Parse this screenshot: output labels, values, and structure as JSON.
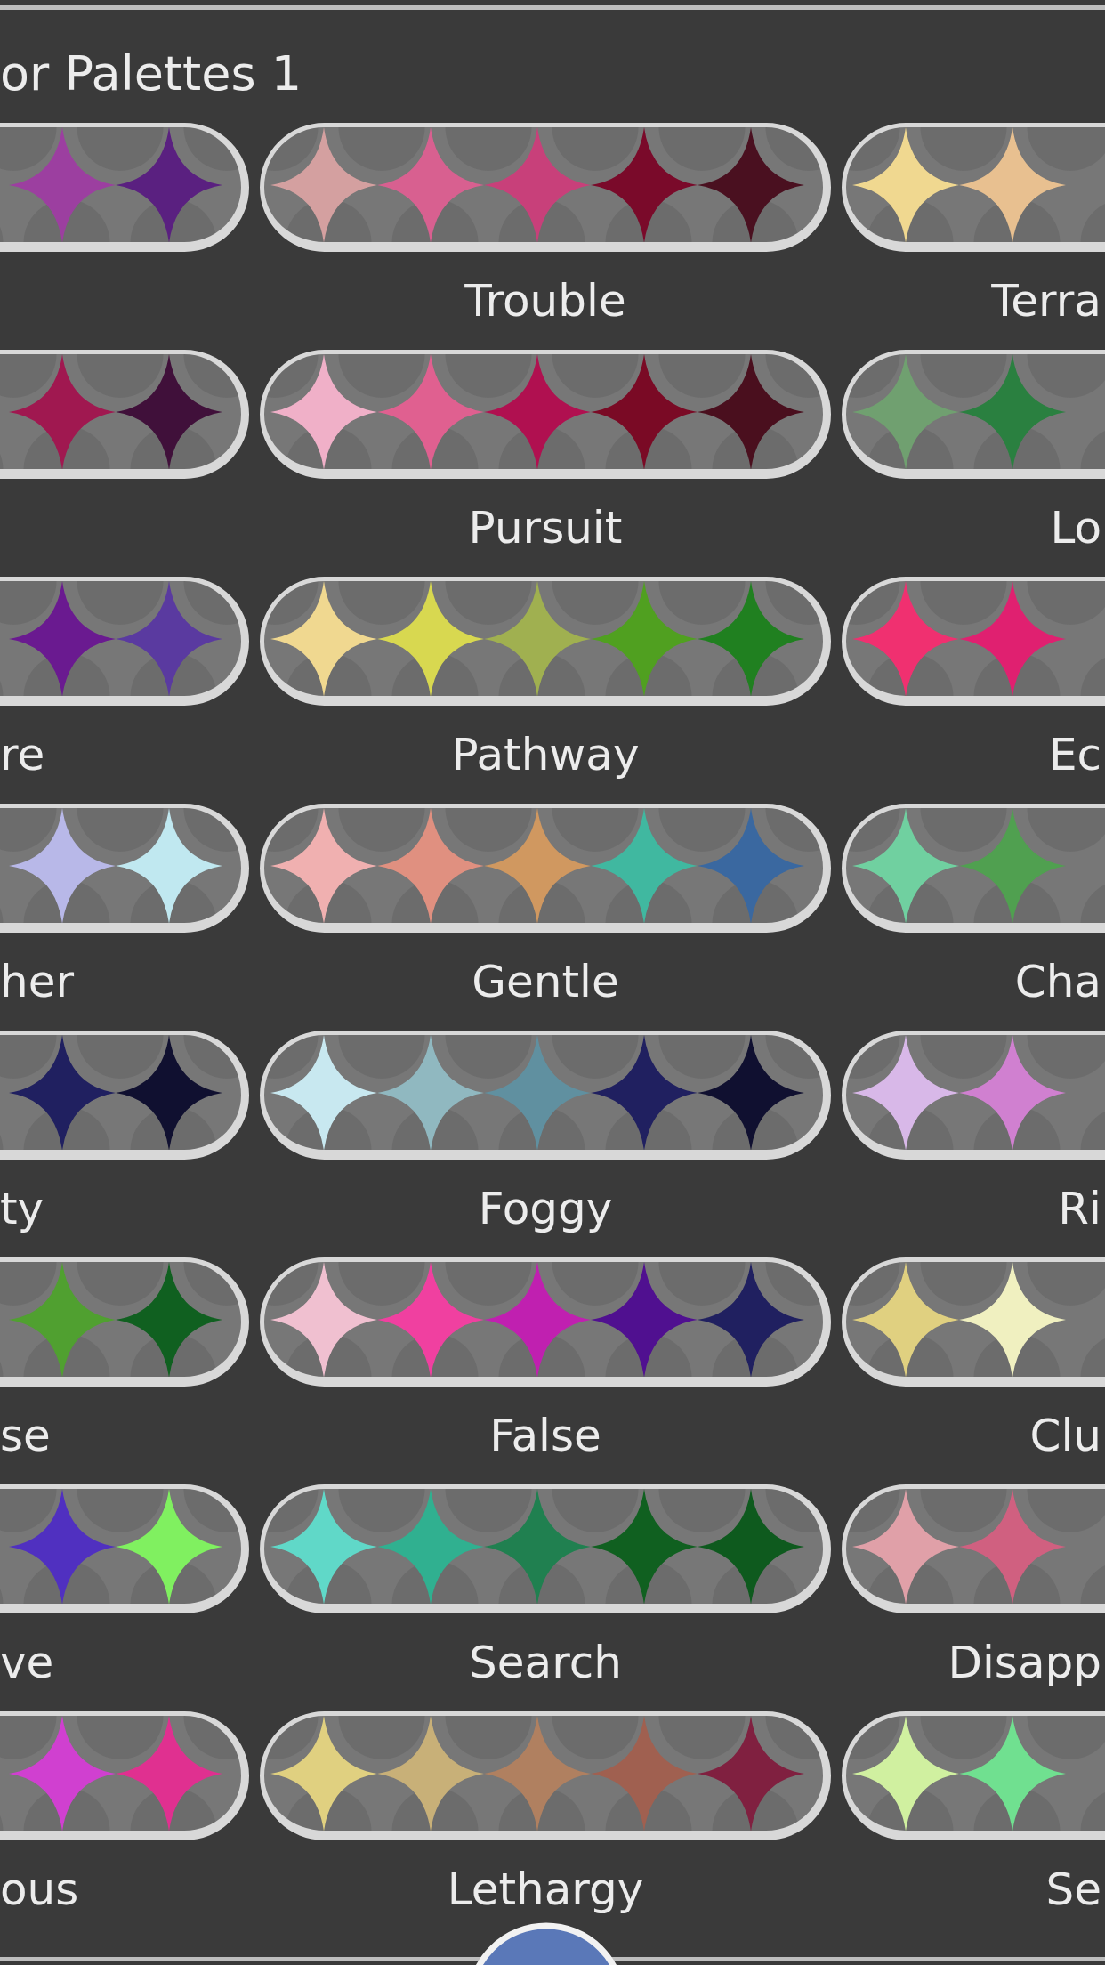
{
  "title": "or Palettes 1",
  "palettes": [
    {
      "kind": "left",
      "stars": [
        {
          "color": "#9c3fa0"
        },
        {
          "color": "#5a2080"
        }
      ]
    },
    {
      "kind": "middle",
      "label": "Trouble",
      "stars": [
        {
          "color": "#d4a0a0"
        },
        {
          "color": "#d86090"
        },
        {
          "color": "#c8407a"
        },
        {
          "color": "#7a0a2a"
        },
        {
          "color": "#4a1020"
        }
      ]
    },
    {
      "kind": "right",
      "label": "Terra",
      "stars": [
        {
          "color": "#f0d890"
        },
        {
          "color": "#e8c090"
        }
      ]
    },
    {
      "kind": "left",
      "stars": [
        {
          "color": "#a01850"
        },
        {
          "color": "#40103a"
        }
      ]
    },
    {
      "kind": "middle",
      "label": "Pursuit",
      "stars": [
        {
          "color": "#f0b0c8"
        },
        {
          "color": "#e06090"
        },
        {
          "color": "#b01050"
        },
        {
          "color": "#7a0a25"
        },
        {
          "color": "#4a0f1e"
        }
      ]
    },
    {
      "kind": "right",
      "label": "Lo",
      "stars": [
        {
          "color": "#70a070"
        },
        {
          "color": "#2a8040"
        }
      ]
    },
    {
      "kind": "left",
      "label": "re",
      "stars": [
        {
          "color": "#6a1a90"
        },
        {
          "color": "#5a3aa0"
        }
      ]
    },
    {
      "kind": "middle",
      "label": "Pathway",
      "stars": [
        {
          "color": "#f0d890"
        },
        {
          "color": "#d8d850"
        },
        {
          "color": "#a0b050"
        },
        {
          "color": "#50a020"
        },
        {
          "color": "#208020"
        }
      ]
    },
    {
      "kind": "right",
      "label": "Ec",
      "stars": [
        {
          "color": "#f03070"
        },
        {
          "color": "#e02070"
        }
      ]
    },
    {
      "kind": "left",
      "label": "her",
      "stars": [
        {
          "color": "#b8b8e8"
        },
        {
          "color": "#c0e8f0"
        }
      ]
    },
    {
      "kind": "middle",
      "label": "Gentle",
      "stars": [
        {
          "color": "#f0b0b0"
        },
        {
          "color": "#e09080"
        },
        {
          "color": "#d09860"
        },
        {
          "color": "#40b8a0"
        },
        {
          "color": "#3a68a0"
        }
      ]
    },
    {
      "kind": "right",
      "label": "Cha",
      "stars": [
        {
          "color": "#70d0a0"
        },
        {
          "color": "#50a050"
        }
      ]
    },
    {
      "kind": "left",
      "label": "ty",
      "stars": [
        {
          "color": "#202060"
        },
        {
          "color": "#101030"
        }
      ]
    },
    {
      "kind": "middle",
      "label": "Foggy",
      "stars": [
        {
          "color": "#c8e8f0"
        },
        {
          "color": "#90b8c0"
        },
        {
          "color": "#6090a0"
        },
        {
          "color": "#202060"
        },
        {
          "color": "#101030"
        }
      ]
    },
    {
      "kind": "right",
      "label": "Ri",
      "stars": [
        {
          "color": "#d8b8e8"
        },
        {
          "color": "#d080d0"
        }
      ]
    },
    {
      "kind": "left",
      "label": "se",
      "stars": [
        {
          "color": "#50a030"
        },
        {
          "color": "#106020"
        }
      ]
    },
    {
      "kind": "middle",
      "label": "False",
      "stars": [
        {
          "color": "#f0c0d0"
        },
        {
          "color": "#f040a0"
        },
        {
          "color": "#c020b0"
        },
        {
          "color": "#501090"
        },
        {
          "color": "#202060"
        }
      ]
    },
    {
      "kind": "right",
      "label": "Clu",
      "stars": [
        {
          "color": "#e0d080"
        },
        {
          "color": "#f0f0c0"
        }
      ]
    },
    {
      "kind": "left",
      "label": "ve",
      "stars": [
        {
          "color": "#5030c0"
        },
        {
          "color": "#80f060"
        }
      ]
    },
    {
      "kind": "middle",
      "label": "Search",
      "stars": [
        {
          "color": "#60d8c8"
        },
        {
          "color": "#30b090"
        },
        {
          "color": "#208050"
        },
        {
          "color": "#106020"
        },
        {
          "color": "#0e5a1e"
        }
      ]
    },
    {
      "kind": "right",
      "label": "Disapp",
      "stars": [
        {
          "color": "#e0a0a8"
        },
        {
          "color": "#d06080"
        }
      ]
    },
    {
      "kind": "left",
      "label": "ous",
      "stars": [
        {
          "color": "#d040d0"
        },
        {
          "color": "#e03090"
        }
      ]
    },
    {
      "kind": "middle",
      "label": "Lethargy",
      "stars": [
        {
          "color": "#e0d080"
        },
        {
          "color": "#c8b078"
        },
        {
          "color": "#b08060"
        },
        {
          "color": "#a06050"
        },
        {
          "color": "#802040"
        }
      ]
    },
    {
      "kind": "right",
      "label": "Se",
      "stars": [
        {
          "color": "#d0f0a0"
        },
        {
          "color": "#70e090"
        }
      ]
    }
  ]
}
